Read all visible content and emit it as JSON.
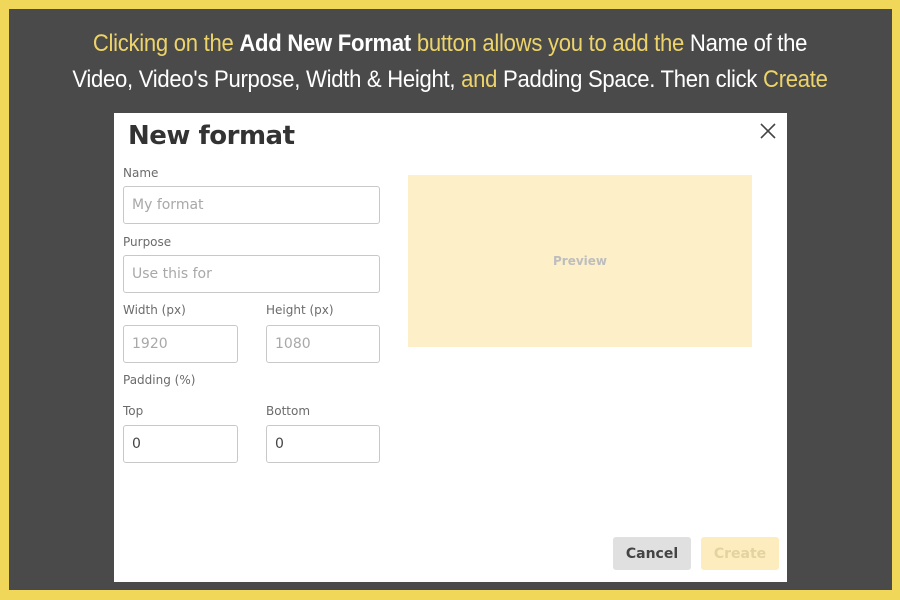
{
  "caption": {
    "line1": [
      {
        "text": "Clicking on the ",
        "style": "hl"
      },
      {
        "text": "Add New Format",
        "style": "b"
      },
      {
        "text": " button allows you to add the ",
        "style": "hl"
      },
      {
        "text": "Name of the",
        "style": "plain"
      }
    ],
    "line2": [
      {
        "text": "Video, Video's Purpose, Width & Height, ",
        "style": "plain"
      },
      {
        "text": "and",
        "style": "hl"
      },
      {
        "text": " Padding Space. Then click ",
        "style": "plain"
      },
      {
        "text": "Create",
        "style": "hl"
      }
    ]
  },
  "dialog": {
    "title": "New format",
    "close_icon": "close-icon",
    "fields": {
      "name": {
        "label": "Name",
        "placeholder": "My format",
        "value": ""
      },
      "purpose": {
        "label": "Purpose",
        "placeholder": "Use this for",
        "value": ""
      },
      "width": {
        "label": "Width (px)",
        "placeholder": "1920",
        "value": ""
      },
      "height": {
        "label": "Height (px)",
        "placeholder": "1080",
        "value": ""
      },
      "padding_heading": "Padding (%)",
      "top": {
        "label": "Top",
        "value": "0"
      },
      "bottom": {
        "label": "Bottom",
        "value": "0"
      }
    },
    "preview_label": "Preview",
    "buttons": {
      "cancel": "Cancel",
      "create": "Create"
    }
  },
  "colors": {
    "border_yellow": "#f0d75a",
    "background_dark": "#4a4a4a",
    "highlight_text": "#ecd36a",
    "preview_bg": "#fdf0c9",
    "create_disabled_bg": "#fcecbe",
    "cancel_bg": "#e0e0e0"
  }
}
